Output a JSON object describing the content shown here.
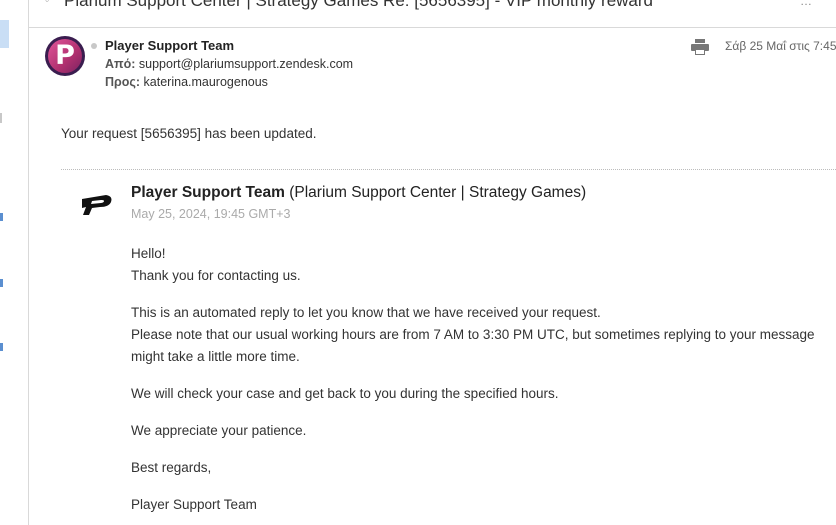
{
  "subject": {
    "text": "Plarium Support Center | Strategy Games Re: [5656395] - VIP monthly reward",
    "bullet": "◦",
    "more": "…"
  },
  "header": {
    "avatar_letter": "P",
    "sender_name": "Player Support Team",
    "from_label": "Από:",
    "from_value": "support@plariumsupport.zendesk.com",
    "to_label": "Προς:",
    "to_value": "katerina.maurogenous",
    "date": "Σάβ 25 Μαΐ στις 7:45"
  },
  "intro": "Your request [5656395] has been updated.",
  "message": {
    "author_bold": "Player Support Team",
    "author_rest": " (Plarium Support Center | Strategy Games)",
    "date": "May 25, 2024, 19:45 GMT+3",
    "lines": [
      "Hello!",
      "Thank you for contacting us.",
      "This is an automated reply to let you know that we have received your request.",
      "Please note that our usual working hours are from 7 AM to 3:30 PM UTC, but sometimes replying to your message",
      "might take a little more time.",
      "We will check your case and get back to you during the specified hours.",
      "We appreciate your patience.",
      "Best regards,",
      "Player Support Team"
    ]
  },
  "colors": {
    "avatar_bg": "#3a1d4f",
    "avatar_accent": "#d04a8a",
    "rail_highlight": "#c9def5"
  },
  "icons": [
    "print-icon",
    "plarium-logo-icon",
    "unread-dot-icon"
  ]
}
